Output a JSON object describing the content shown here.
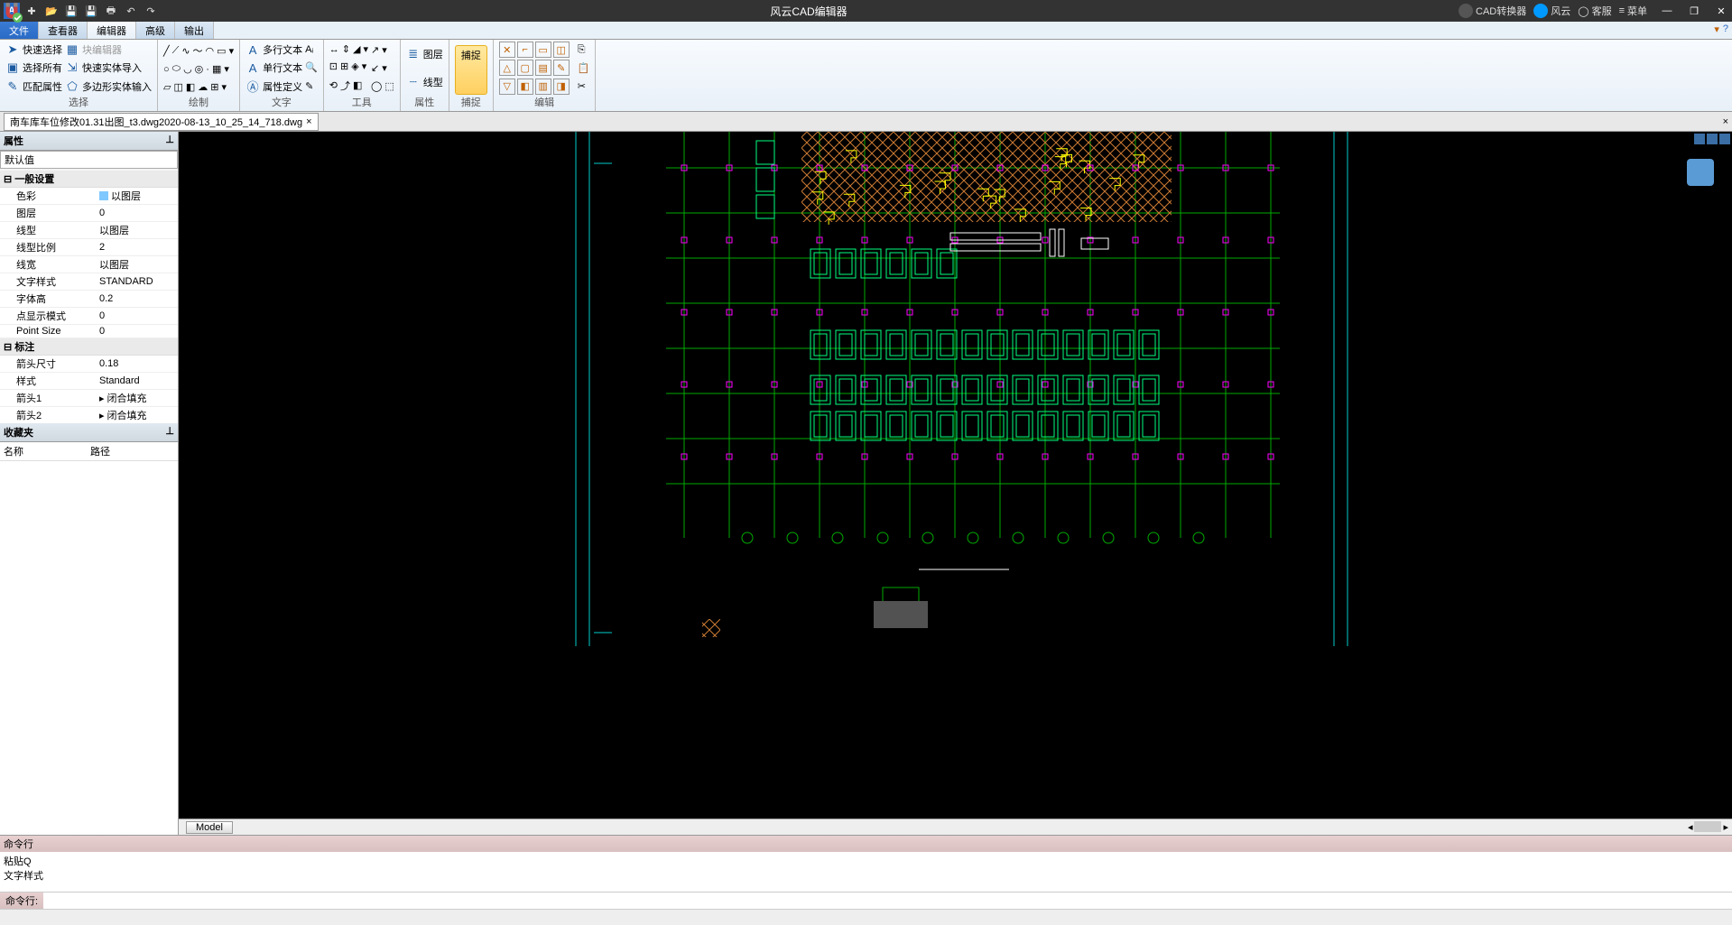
{
  "app": {
    "title": "风云CAD编辑器"
  },
  "titlebar_right": {
    "converter": "CAD转换器",
    "brand": "风云",
    "support": "客服",
    "menu": "菜单"
  },
  "menu_tabs": {
    "file": "文件",
    "viewer": "查看器",
    "editor": "编辑器",
    "advanced": "高级",
    "output": "输出"
  },
  "ribbon": {
    "select_group": {
      "quick_select": "快速选择",
      "block_editor": "块编辑器",
      "select_all": "选择所有",
      "quick_import": "快速实体导入",
      "match_props": "匹配属性",
      "poly_import": "多边形实体输入",
      "label": "选择"
    },
    "draw_label": "绘制",
    "text": {
      "mtext": "多行文本",
      "dtext": "单行文本",
      "attdef": "属性定义",
      "label": "文字"
    },
    "tool_label": "工具",
    "layer": {
      "layer": "图层",
      "linetype": "线型",
      "label": "属性"
    },
    "snap": {
      "label": "捕捉",
      "caption": "捕捉"
    },
    "edit_label": "编辑"
  },
  "doc": {
    "filename": "南车库车位修改01.31出图_t3.dwg2020-08-13_10_25_14_718.dwg"
  },
  "prop_panel": {
    "title": "属性",
    "default": "默认值",
    "cat_general": "一般设置",
    "rows": {
      "color": {
        "k": "色彩",
        "v": "以图层"
      },
      "layer": {
        "k": "图层",
        "v": "0"
      },
      "linetype": {
        "k": "线型",
        "v": "以图层"
      },
      "ltscale": {
        "k": "线型比例",
        "v": "2"
      },
      "lineweight": {
        "k": "线宽",
        "v": "以图层"
      },
      "textstyle": {
        "k": "文字样式",
        "v": "STANDARD"
      },
      "textheight": {
        "k": "字体高",
        "v": "0.2"
      },
      "ptmode": {
        "k": "点显示模式",
        "v": "0"
      },
      "ptsize": {
        "k": "Point Size",
        "v": "0"
      }
    },
    "cat_dim": "标注",
    "dimrows": {
      "arrowsize": {
        "k": "箭头尺寸",
        "v": "0.18"
      },
      "style": {
        "k": "样式",
        "v": "Standard"
      },
      "arrow1": {
        "k": "箭头1",
        "v": "闭合填充"
      },
      "arrow2": {
        "k": "箭头2",
        "v": "闭合填充"
      }
    }
  },
  "fav_panel": {
    "title": "收藏夹",
    "col_name": "名称",
    "col_path": "路径"
  },
  "modelbar": {
    "model": "Model"
  },
  "command": {
    "title": "命令行",
    "hist1": "粘贴Q",
    "hist2": "文字样式",
    "prompt": "命令行:",
    "value": ""
  }
}
